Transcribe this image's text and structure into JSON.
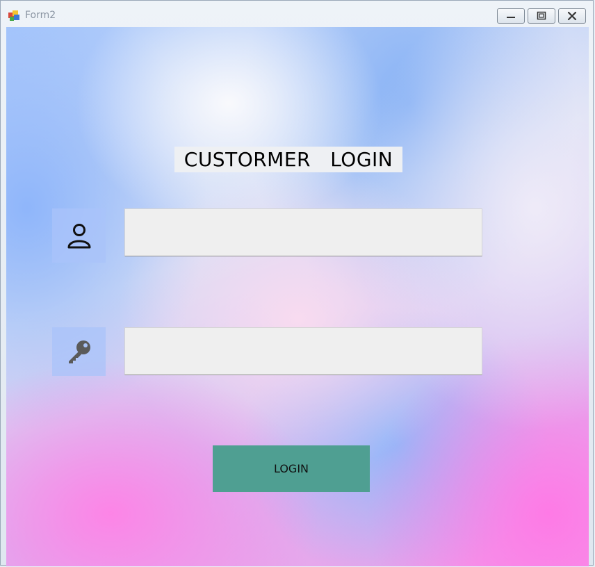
{
  "window": {
    "title": "Form2",
    "controls": {
      "minimize_icon": "minimize-icon",
      "maximize_icon": "maximize-icon",
      "close_icon": "close-icon"
    }
  },
  "form": {
    "heading": "CUSTORMER   LOGIN",
    "username": {
      "icon": "user-icon",
      "value": "",
      "placeholder": ""
    },
    "password": {
      "icon": "key-icon",
      "value": "",
      "placeholder": ""
    },
    "login_label": "LOGIN"
  },
  "colors": {
    "button": "#4f9f92",
    "field": "#efefef",
    "icon_box": "#aac3fa"
  }
}
